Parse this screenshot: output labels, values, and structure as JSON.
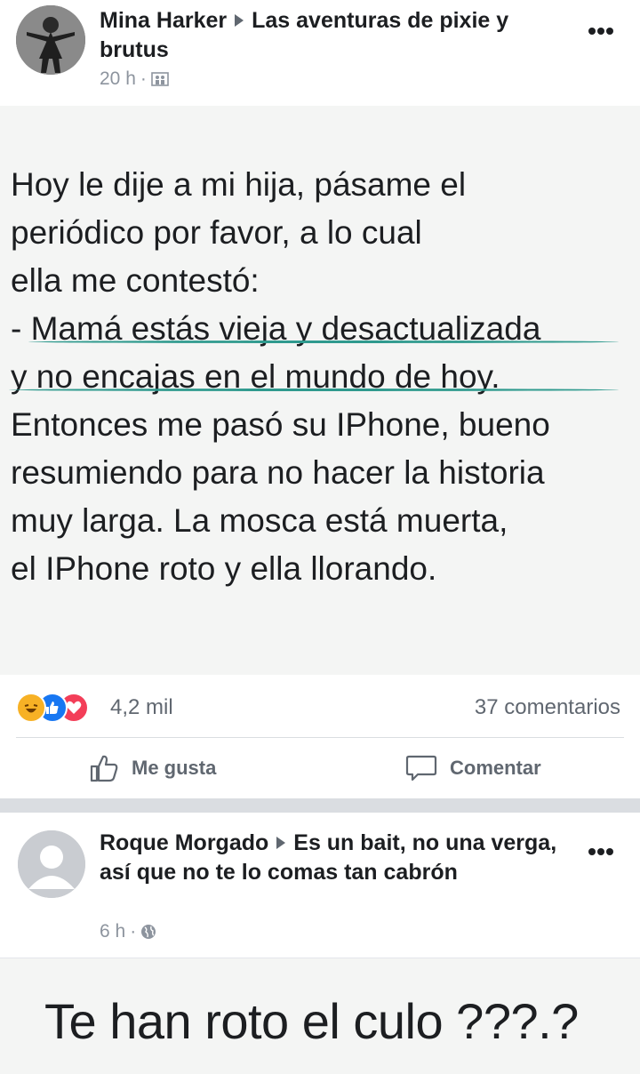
{
  "post1": {
    "author": "Mina Harker",
    "group": "Las aventuras de pixie y brutus",
    "time": "20 h",
    "separator": "·",
    "content": "Hoy le dije a mi hija, pásame el\nperiódico por favor, a lo cual\nella me contestó:\n- Mamá estás vieja y desactualizada\ny no encajas en el mundo de hoy.\nEntonces me pasó su IPhone, bueno\nresumiendo para no hacer la historia\nmuy larga. La mosca está muerta,\nel IPhone roto y ella llorando.",
    "reaction_count": "4,2 mil",
    "comment_count": "37 comentarios",
    "actions": {
      "like": "Me gusta",
      "comment": "Comentar"
    }
  },
  "post2": {
    "author": "Roque Morgado",
    "group": "Es un bait, no una verga, así que no te lo comas tan cabrón",
    "time": "6 h",
    "separator": "·",
    "content": "Te han roto el culo ???.?"
  },
  "colors": {
    "underline": "#2f9a8e",
    "like_blue": "#1877f2",
    "love_red": "#f33e58",
    "haha_yellow": "#f7b125"
  },
  "icons": [
    "more-options-icon",
    "group-members-icon",
    "globe-icon",
    "like-thumb-icon",
    "comment-bubble-icon",
    "caret-right-icon"
  ]
}
